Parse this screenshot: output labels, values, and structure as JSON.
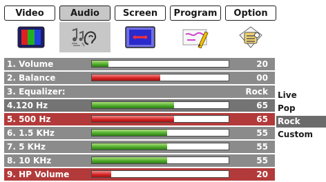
{
  "tabs": [
    {
      "label": "Video",
      "active": false
    },
    {
      "label": "Audio",
      "active": true
    },
    {
      "label": "Screen",
      "active": false
    },
    {
      "label": "Program",
      "active": false
    },
    {
      "label": "Option",
      "active": false
    }
  ],
  "icons": [
    {
      "name": "color-bars-icon"
    },
    {
      "name": "audio-ear-icon"
    },
    {
      "name": "screen-icon"
    },
    {
      "name": "program-pencil-icon"
    },
    {
      "name": "option-lock-icon"
    }
  ],
  "rows": [
    {
      "label": "1. Volume",
      "value": "20",
      "bar": {
        "color": "green",
        "level": 0.12
      }
    },
    {
      "label": "2. Balance",
      "value": "00",
      "bar": {
        "color": "red",
        "level": 0.5
      }
    },
    {
      "label": "3. Equalizer:",
      "value": "Rock",
      "bar": null
    },
    {
      "label": "4.120  Hz",
      "value": "65",
      "bar": {
        "color": "green",
        "level": 0.6
      }
    },
    {
      "label": "5. 500 Hz",
      "value": "65",
      "bar": {
        "color": "red",
        "level": 0.6
      }
    },
    {
      "label": "6. 1.5  KHz",
      "value": "55",
      "bar": {
        "color": "green",
        "level": 0.55
      }
    },
    {
      "label": "7. 5  KHz",
      "value": "55",
      "bar": {
        "color": "green",
        "level": 0.55
      }
    },
    {
      "label": "8. 10  KHz",
      "value": "55",
      "bar": {
        "color": "green",
        "level": 0.55
      }
    },
    {
      "label": "9. HP Volume",
      "value": "20",
      "bar": {
        "color": "red",
        "level": 0.14
      }
    }
  ],
  "presets": [
    {
      "label": "Live",
      "selected": false
    },
    {
      "label": "Pop",
      "selected": false
    },
    {
      "label": "Rock",
      "selected": true
    },
    {
      "label": "Custom",
      "selected": false
    }
  ]
}
